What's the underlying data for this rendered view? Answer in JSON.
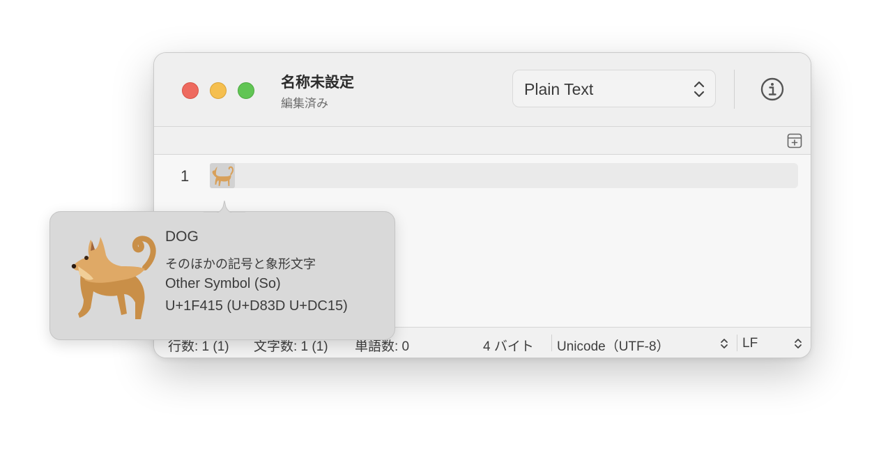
{
  "window": {
    "title": "名称未設定",
    "subtitle": "編集済み"
  },
  "toolbar": {
    "syntax_value": "Plain Text"
  },
  "editor": {
    "line_numbers": [
      "1"
    ],
    "selected_character": "dog-emoji"
  },
  "statusbar": {
    "lines": "行数: 1 (1)",
    "chars": "文字数: 1 (1)",
    "words": "単語数: 0",
    "bytes": "4 バイト",
    "encoding": "Unicode（UTF-8）",
    "line_ending": "LF"
  },
  "popover": {
    "name": "DOG",
    "category": "そのほかの記号と象形文字",
    "general_category": "Other Symbol (So)",
    "codepoint": "U+1F415 (U+D83D U+DC15)"
  },
  "colors": {
    "close": "#ee6a5f",
    "minimize": "#f5bf4f",
    "zoom": "#61c554",
    "dog_fur": "#d8a05a"
  }
}
